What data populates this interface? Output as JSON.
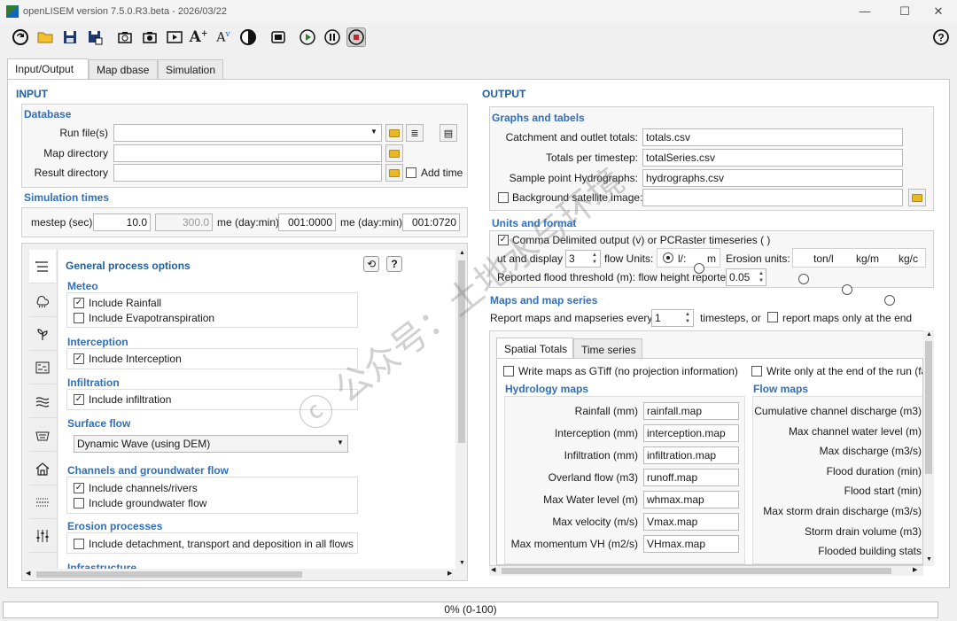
{
  "window": {
    "title": "openLISEM version 7.5.0.R3.beta - 2026/03/22"
  },
  "tabs": [
    "Input/Output",
    "Map dbase",
    "Simulation"
  ],
  "input": {
    "heading": "INPUT",
    "database": {
      "heading": "Database",
      "run_files_label": "Run file(s)",
      "map_dir_label": "Map directory",
      "result_dir_label": "Result directory",
      "add_time_label": "Add time",
      "run_files_value": "",
      "map_dir_value": "",
      "result_dir_value": ""
    },
    "simtimes": {
      "heading": "Simulation times",
      "timestep_label": "mestep (sec)",
      "timestep_value": "10.0",
      "disabled_value": "300.0",
      "start_label": "me (day:min)",
      "start_value": "001:0000",
      "end_label": "me (day:min)",
      "end_value": "001:0720"
    },
    "process": {
      "heading": "General process options",
      "meteo": {
        "heading": "Meteo",
        "rainfall": "Include Rainfall",
        "evapo": "Include Evapotranspiration"
      },
      "interception": {
        "heading": "Interception",
        "label": "Include Interception"
      },
      "infiltration": {
        "heading": "Infiltration",
        "label": "Include infiltration"
      },
      "surface": {
        "heading": "Surface flow",
        "value": "Dynamic Wave (using DEM)"
      },
      "channels": {
        "heading": "Channels and groundwater flow",
        "rivers": "Include channels/rivers",
        "ground": "Include groundwater flow"
      },
      "erosion": {
        "heading": "Erosion processes",
        "label": "Include detachment, transport and deposition in all flows"
      },
      "infra": {
        "heading": "Infrastructure"
      }
    }
  },
  "output": {
    "heading": "OUTPUT",
    "graphs": {
      "heading": "Graphs and tabels",
      "catchment_label": "Catchment and outlet totals:",
      "catchment_value": "totals.csv",
      "totals_label": "Totals per timestep:",
      "totals_value": "totalSeries.csv",
      "sample_label": "Sample point Hydrographs:",
      "sample_value": "hydrographs.csv",
      "bg_label": "Background satellite image:",
      "bg_value": ""
    },
    "units": {
      "heading": "Units and format",
      "csv_label": "Comma Delimited output (v) or PCRaster timeseries ( )",
      "display_label": "ut and display",
      "display_value": "3",
      "flow_units_label": "flow Units:",
      "flow_l": "l/:",
      "flow_m": "m",
      "erosion_label": "Erosion units:",
      "ton": "ton/l",
      "kg": "kg/m",
      "kgc": "kg/c",
      "flood_label": "Reported flood threshold (m): flow height reporte",
      "flood_value": "0.05"
    },
    "maps": {
      "heading": "Maps and map series",
      "every_label": "Report maps and mapseries every:",
      "every_value": "1",
      "timesteps_label": "timesteps, or",
      "end_only_label": "report maps only at the end",
      "subtabs": [
        "Spatial Totals",
        "Time series"
      ],
      "gtiff_label": "Write maps as GTiff (no projection information)",
      "end_run_label": "Write only at the end of the run (fa",
      "hydro_heading": "Hydrology maps",
      "flow_heading": "Flow maps",
      "hydro": [
        {
          "label": "Rainfall (mm)",
          "value": "rainfall.map"
        },
        {
          "label": "Interception (mm)",
          "value": "interception.map"
        },
        {
          "label": "Infiltration (mm)",
          "value": "infiltration.map"
        },
        {
          "label": "Overland flow (m3)",
          "value": "runoff.map"
        },
        {
          "label": "Max Water level  (m)",
          "value": "whmax.map"
        },
        {
          "label": "Max velocity (m/s)",
          "value": "Vmax.map"
        },
        {
          "label": "Max momentum VH (m2/s)",
          "value": "VHmax.map"
        }
      ],
      "flow": [
        "Cumulative channel discharge (m3)",
        "Max channel water level (m)",
        "Max discharge (m3/s)",
        "Flood duration (min)",
        "Flood start (min)",
        "Max storm drain discharge (m3/s)",
        "Storm drain volume (m3)",
        "Flooded building stats"
      ]
    }
  },
  "status": {
    "progress": "0% (0-100)",
    "fraction": 0
  },
  "watermark": "ⓒ 公众号：土地水与环境"
}
